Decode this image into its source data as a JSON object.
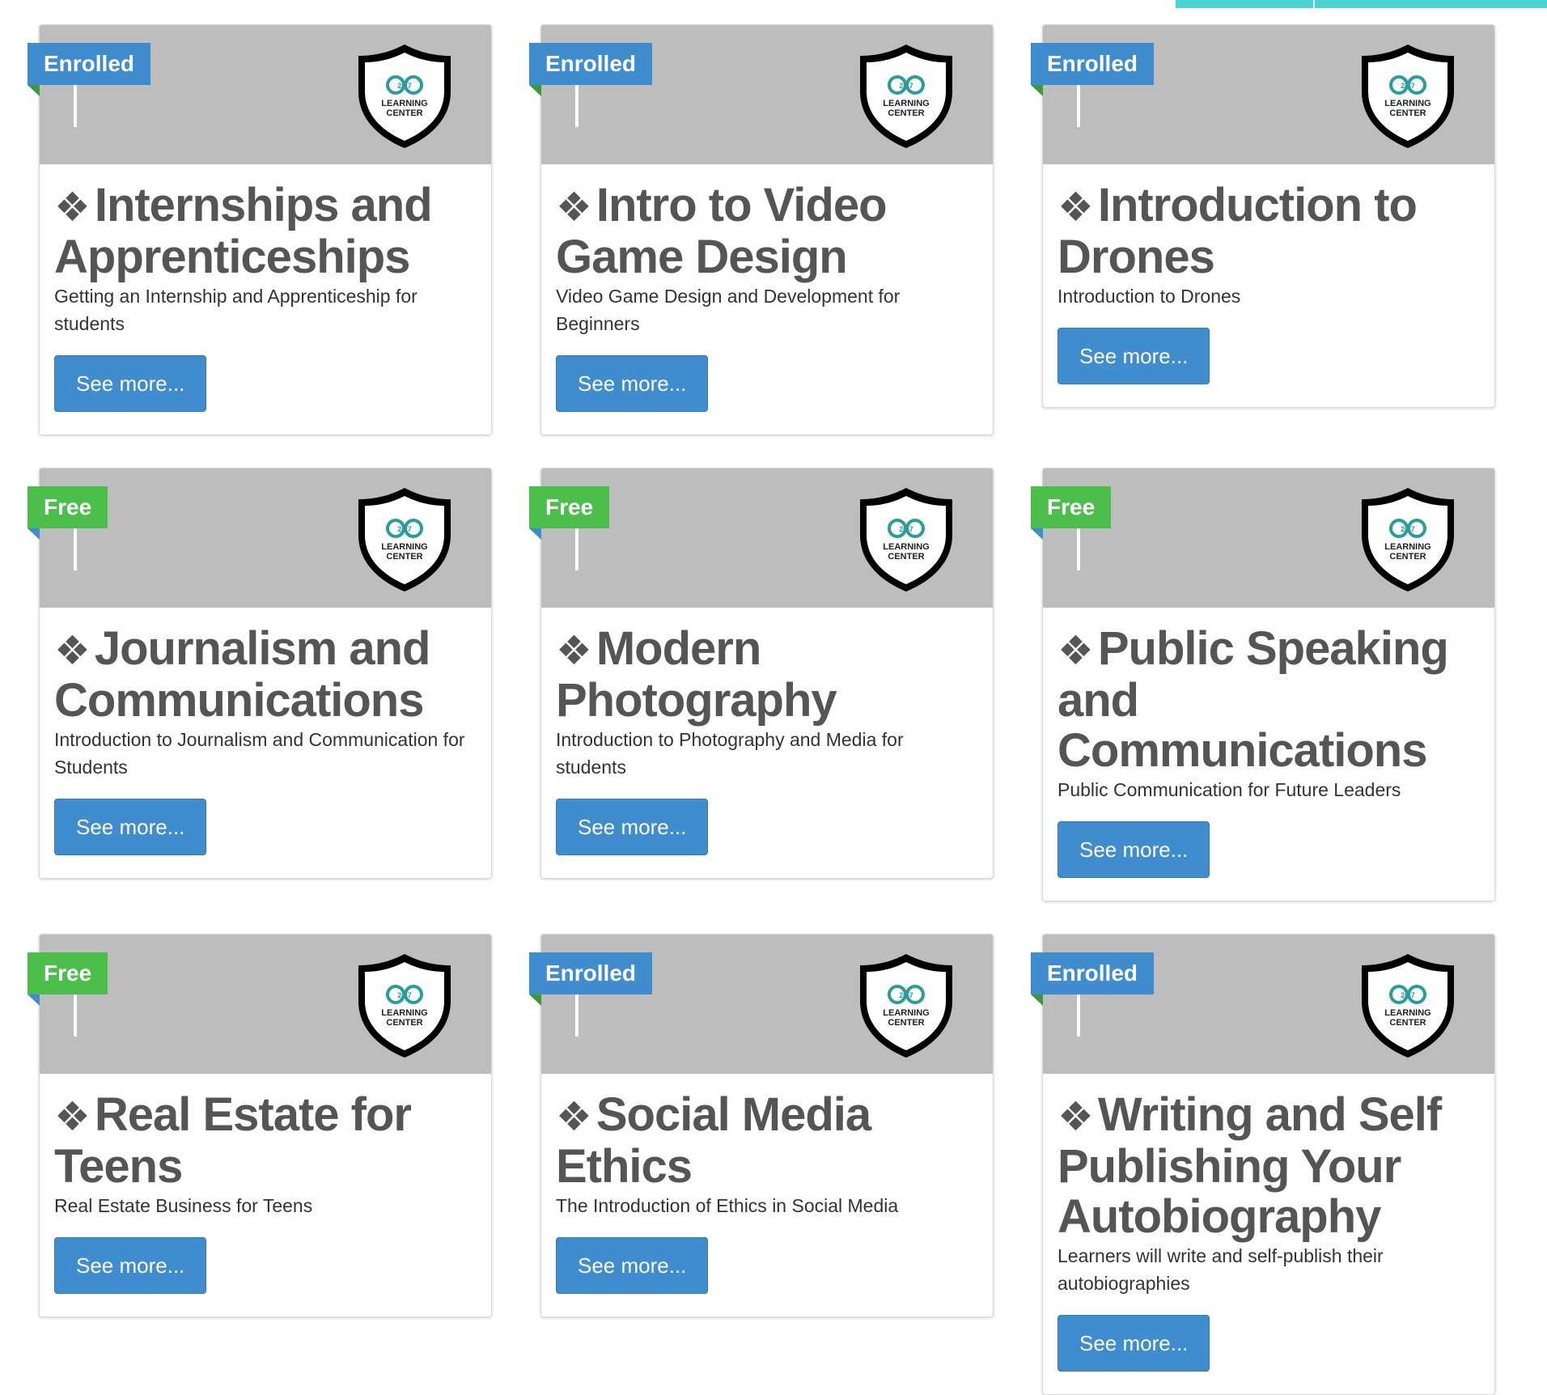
{
  "colors": {
    "enrolled_badge": "#3f8ccf",
    "enrolled_fold": "#3a9a3a",
    "free_badge": "#4cbe4c",
    "free_fold": "#3f8ccf",
    "header_bg": "#bdbdbd",
    "button_bg": "#3f8ccf",
    "top_accent": "#4cd4d4"
  },
  "card_common": {
    "title_icon": "diamond-ornament-icon",
    "header_icon": "learning-center-shield-logo",
    "logo_text_number": "24 7",
    "logo_text_line1": "LEARNING",
    "logo_text_line2": "CENTER"
  },
  "courses": [
    {
      "badge": "Enrolled",
      "title": "Internships and Apprenticeships",
      "description": "Getting an Internship and Apprenticeship for students",
      "button": "See more..."
    },
    {
      "badge": "Enrolled",
      "title": "Intro to Video Game Design",
      "description": "Video Game Design and Development for Beginners",
      "button": "See more..."
    },
    {
      "badge": "Enrolled",
      "title": "Introduction to Drones",
      "description": "Introduction to Drones",
      "button": "See more..."
    },
    {
      "badge": "Free",
      "title": "Journalism and Communications",
      "description": "Introduction to Journalism and Communication for Students",
      "button": "See more..."
    },
    {
      "badge": "Free",
      "title": "Modern Photography",
      "description": "Introduction to Photography and Media for students",
      "button": "See more..."
    },
    {
      "badge": "Free",
      "title": "Public Speaking and Communications",
      "description": "Public Communication for Future Leaders",
      "button": "See more..."
    },
    {
      "badge": "Free",
      "title": "Real Estate for Teens",
      "description": "Real Estate Business for Teens",
      "button": "See more..."
    },
    {
      "badge": "Enrolled",
      "title": "Social Media Ethics",
      "description": "The Introduction of Ethics in Social Media",
      "button": "See more..."
    },
    {
      "badge": "Enrolled",
      "title": "Writing and Self Publishing Your Autobiography",
      "description": "Learners will write and self-publish their autobiographies",
      "button": "See more..."
    }
  ]
}
